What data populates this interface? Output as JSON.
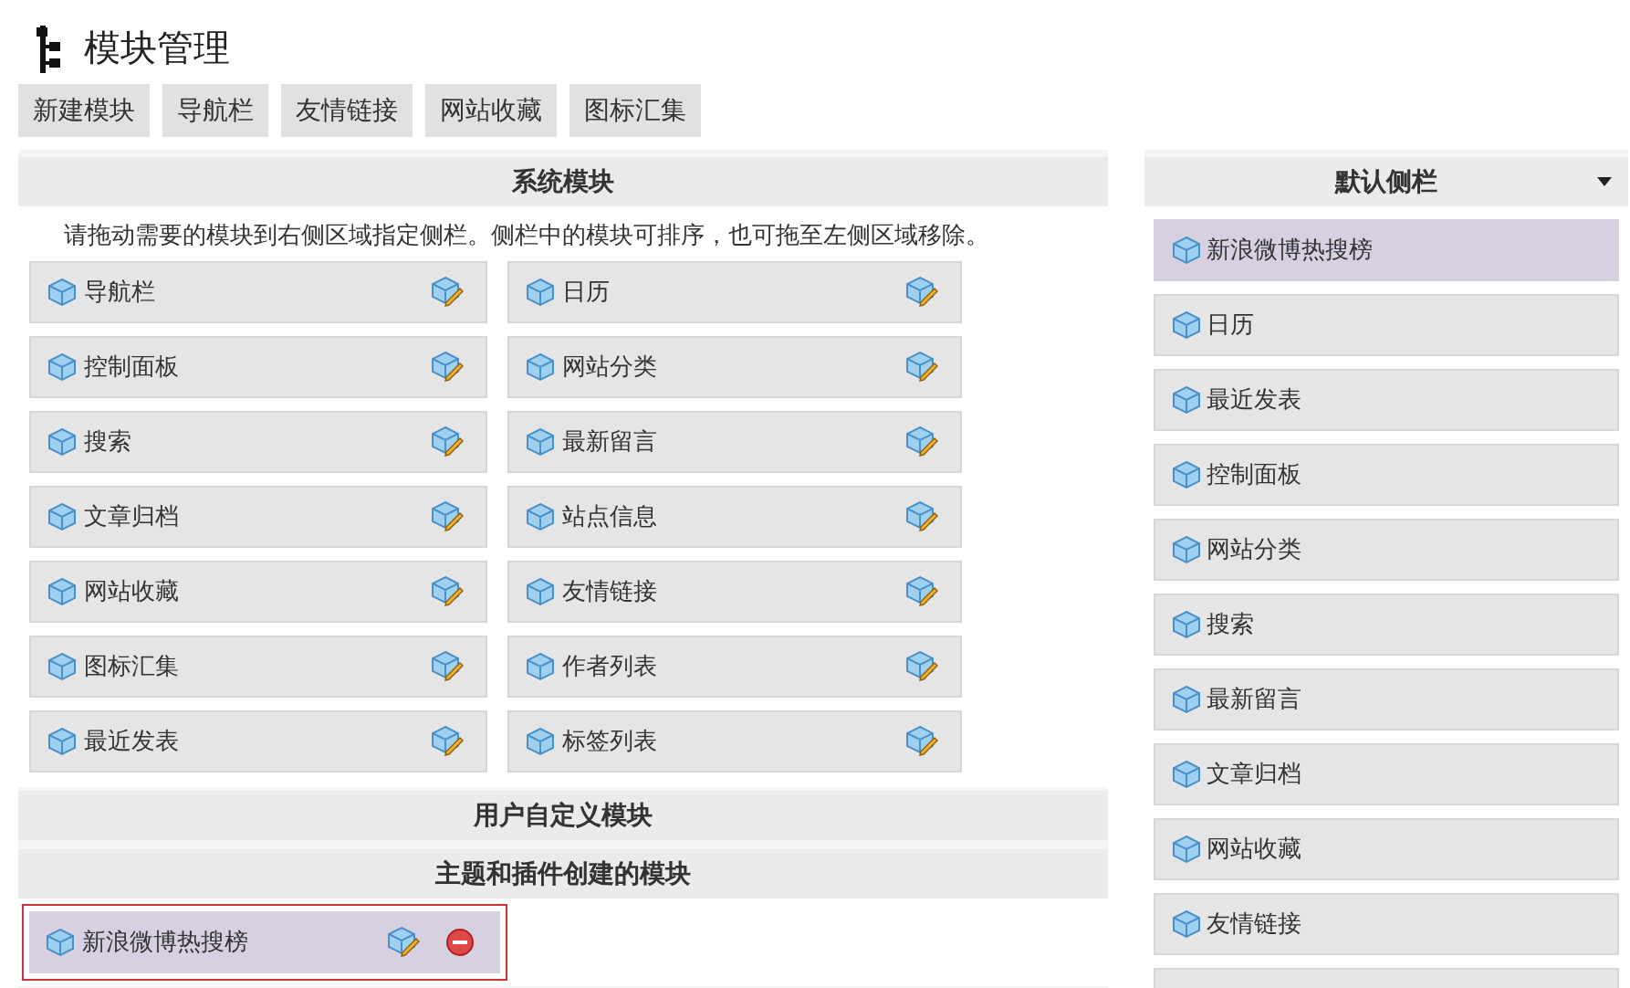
{
  "page_title": "模块管理",
  "tabs": [
    {
      "label": "新建模块"
    },
    {
      "label": "导航栏"
    },
    {
      "label": "友情链接"
    },
    {
      "label": "网站收藏"
    },
    {
      "label": "图标汇集"
    }
  ],
  "system_modules": {
    "title": "系统模块",
    "hint": "请拖动需要的模块到右侧区域指定侧栏。侧栏中的模块可排序，也可拖至左侧区域移除。",
    "items": [
      {
        "label": "导航栏"
      },
      {
        "label": "日历"
      },
      {
        "label": "控制面板"
      },
      {
        "label": "网站分类"
      },
      {
        "label": "搜索"
      },
      {
        "label": "最新留言"
      },
      {
        "label": "文章归档"
      },
      {
        "label": "站点信息"
      },
      {
        "label": "网站收藏"
      },
      {
        "label": "友情链接"
      },
      {
        "label": "图标汇集"
      },
      {
        "label": "作者列表"
      },
      {
        "label": "最近发表"
      },
      {
        "label": "标签列表"
      }
    ]
  },
  "user_modules": {
    "title": "用户自定义模块"
  },
  "plugin_modules": {
    "title": "主题和插件创建的模块",
    "items": [
      {
        "label": "新浪微博热搜榜",
        "highlighted": true
      }
    ]
  },
  "sidebar": {
    "title": "默认侧栏",
    "items": [
      {
        "label": "新浪微博热搜榜",
        "kind": "plugin"
      },
      {
        "label": "日历",
        "kind": "system"
      },
      {
        "label": "最近发表",
        "kind": "system"
      },
      {
        "label": "控制面板",
        "kind": "system"
      },
      {
        "label": "网站分类",
        "kind": "system"
      },
      {
        "label": "搜索",
        "kind": "system"
      },
      {
        "label": "最新留言",
        "kind": "system"
      },
      {
        "label": "文章归档",
        "kind": "system"
      },
      {
        "label": "网站收藏",
        "kind": "system"
      },
      {
        "label": "友情链接",
        "kind": "system"
      }
    ]
  }
}
